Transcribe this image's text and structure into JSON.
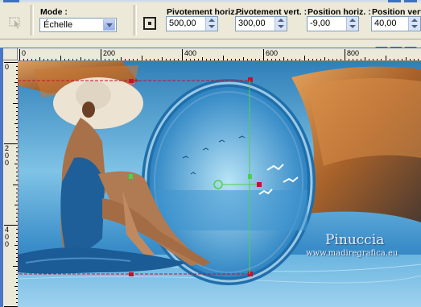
{
  "toolbar": {
    "mode_label": "Mode :",
    "mode_value": "Échelle",
    "pivot_h_label": "Pivotement horiz. :",
    "pivot_h_value": "500,00",
    "pivot_v_label": "Pivotement vert. :",
    "pivot_v_value": "300,00",
    "pos_h_label": "Position horiz. :",
    "pos_h_value": "-9,00",
    "pos_v_label": "Position vert. :",
    "pos_v_value": "40,00"
  },
  "ruler": {
    "h_labels": [
      "0",
      "200",
      "400",
      "600",
      "800"
    ],
    "v_labels": [
      "0",
      "2\n0\n0",
      "4\n0\n0"
    ]
  },
  "watermark": {
    "name": "Pinuccia",
    "url": "www.madiregrafica.eu"
  },
  "colors": {
    "toolbar_bg": "#ece9d8",
    "window_blue": "#4a76c8",
    "selection_red": "#c8102e",
    "handle_green": "#4ad24a"
  }
}
